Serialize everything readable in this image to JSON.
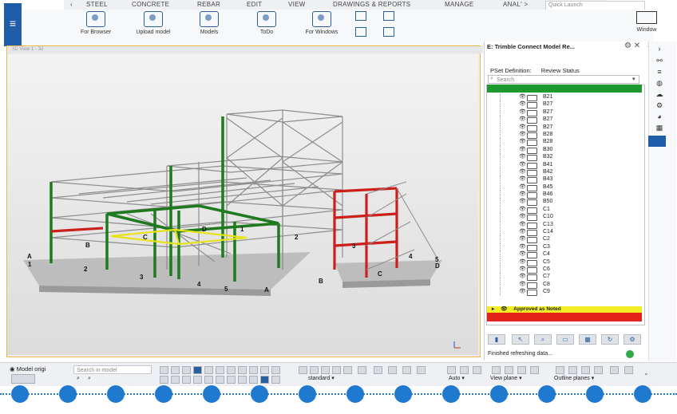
{
  "menu": {
    "tabs": [
      "STEEL",
      "CONCRETE",
      "REBAR",
      "EDIT",
      "VIEW",
      "DRAWINGS & REPORTS",
      "MANAGE",
      "ANAL' >"
    ],
    "quick_launch_placeholder": "Quick Launch"
  },
  "ribbon": {
    "buttons": [
      "For Browser",
      "Upload model",
      "Models",
      "ToDo",
      "For Windows"
    ],
    "window_label": "Window"
  },
  "viewport": {
    "title": "3D View 1 - 3d"
  },
  "scene": {
    "labels": [
      "A",
      "1",
      "B",
      "2",
      "3",
      "4",
      "5",
      "A",
      "B",
      "C",
      "D",
      "1",
      "2",
      "3",
      "4",
      "5",
      "D",
      "C"
    ]
  },
  "panel": {
    "title": "E: Trimble Connect Model Re...",
    "tabs": [
      "PSet Definition:",
      "Review Status"
    ],
    "search_placeholder": "Search",
    "items": [
      "B21",
      "B27",
      "B27",
      "B27",
      "B27",
      "B28",
      "B28",
      "B30",
      "B32",
      "B41",
      "B42",
      "B43",
      "B45",
      "B46",
      "B50",
      "C1",
      "C10",
      "C13",
      "C14",
      "C2",
      "C3",
      "C4",
      "C5",
      "C6",
      "C7",
      "C8",
      "C9"
    ],
    "approved_as_noted": "Approved as Noted",
    "status": "Finished refreshing data..."
  },
  "bottom": {
    "model_origin": "Model origi",
    "search_placeholder": "Search in model",
    "standard": "standard",
    "auto": "Auto",
    "view_plane": "View plane",
    "outline_planes": "Outline planes"
  },
  "colors": {
    "accent": "#1f5da8",
    "green": "#1d9a2f",
    "yellow": "#f2ee25",
    "red": "#e42418",
    "frame_orange": "#f0b44a"
  }
}
